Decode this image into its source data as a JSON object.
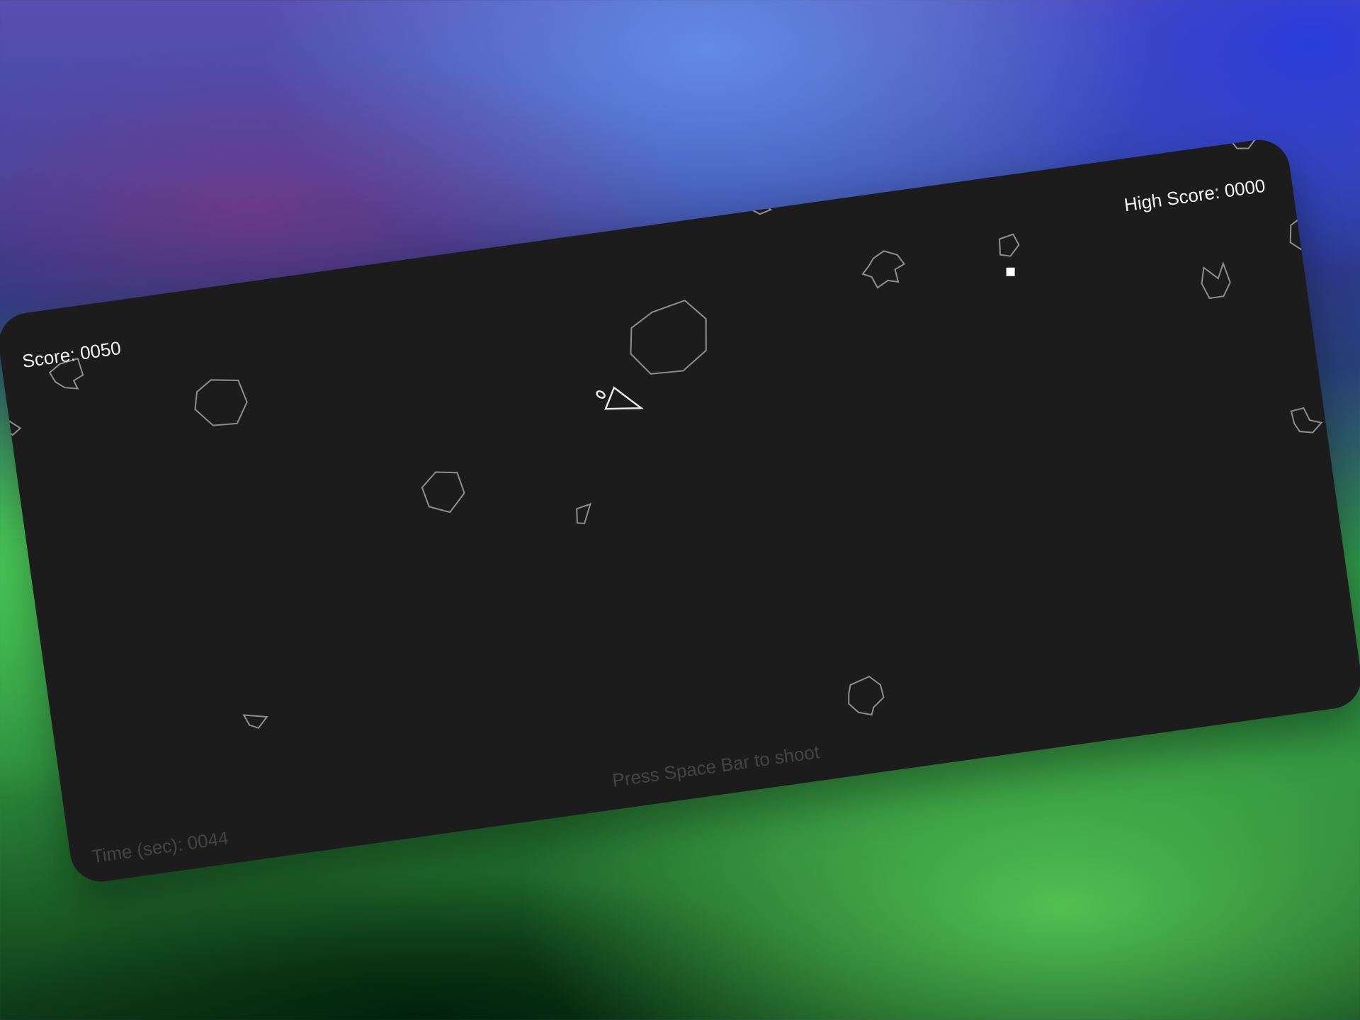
{
  "hud": {
    "score": "Score: 0050",
    "high_score": "High Score: 0000",
    "hint": "Press Space Bar to shoot",
    "timer": "Time (sec): 0044"
  },
  "colors": {
    "board": "#1c1c1d",
    "hud_text": "#f2f2f2",
    "dim_text": "#444446",
    "asteroid_stroke": "#8e8e92",
    "ship_stroke": "#e8e8e8"
  },
  "sprites": {
    "ship": "triangle-ship",
    "bullet": "square-bullet",
    "asteroid": "outline-polygon"
  }
}
